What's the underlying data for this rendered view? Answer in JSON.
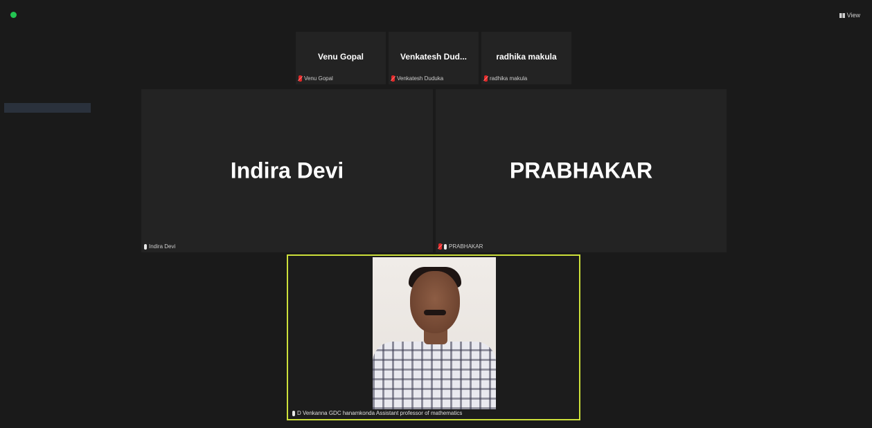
{
  "window": {
    "view_label": "View"
  },
  "participants_top": [
    {
      "display": "Venu Gopal",
      "label": "Venu Gopal",
      "muted": true
    },
    {
      "display": "Venkatesh Dud...",
      "label": "Venkatesh Duduka",
      "muted": true
    },
    {
      "display": "radhika makula",
      "label": "radhika makula",
      "muted": true
    }
  ],
  "participants_main": [
    {
      "display": "Indira Devi",
      "label": "Indira Devi",
      "muted": false
    },
    {
      "display": "PRABHAKAR",
      "label": "PRABHAKAR",
      "muted": true
    }
  ],
  "active_speaker": {
    "label": "D Venkanna GDC hanamkonda Assistant professor of mathematics",
    "muted": false
  },
  "colors": {
    "background": "#1a1a1a",
    "tile": "#232323",
    "active_border": "#cde03a",
    "muted": "#e02828"
  }
}
